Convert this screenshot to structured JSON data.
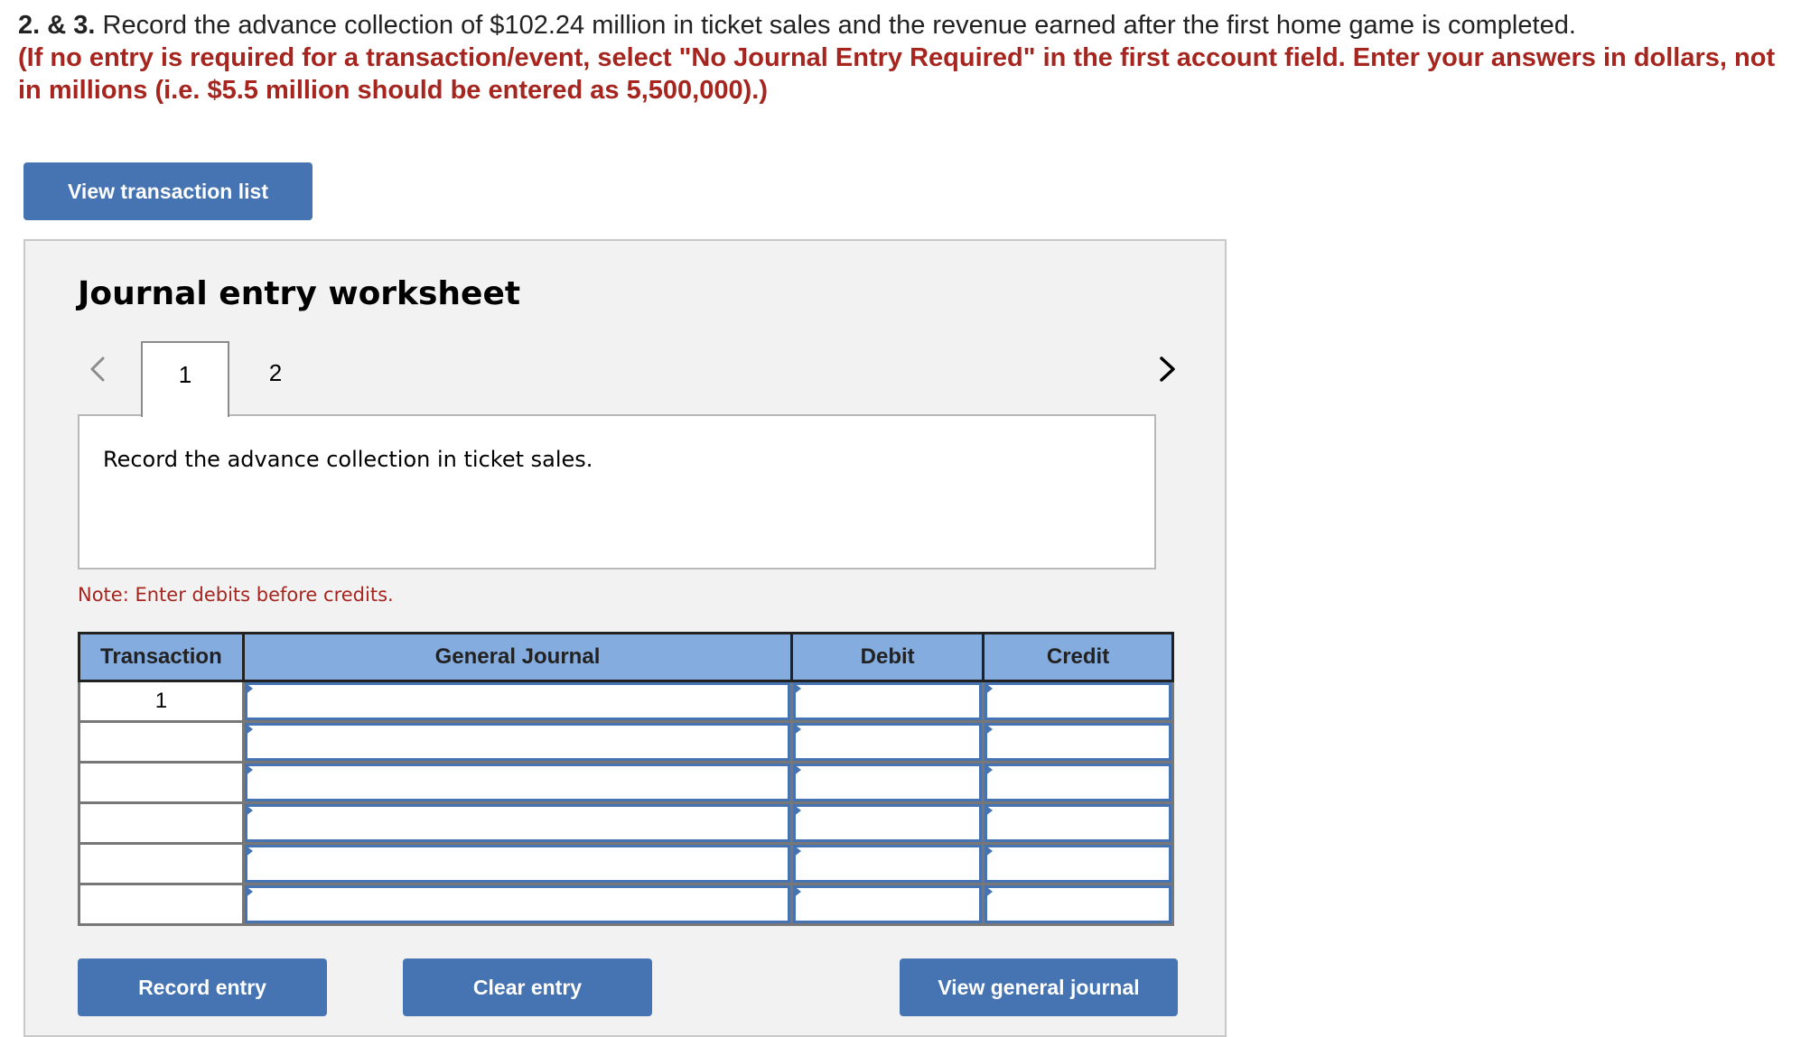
{
  "question": {
    "number": "2. & 3.",
    "text": "Record the advance collection of $102.24 million in ticket sales and the revenue earned after the first home game is completed.",
    "instructions": "(If no entry is required for a transaction/event, select \"No Journal Entry Required\" in the first account field. Enter your answers in dollars, not in millions (i.e. $5.5 million should be entered as 5,500,000).)"
  },
  "buttons": {
    "view_transaction_list": "View transaction list",
    "record_entry": "Record entry",
    "clear_entry": "Clear entry",
    "view_general_journal": "View general journal"
  },
  "worksheet": {
    "title": "Journal entry worksheet",
    "tabs": [
      {
        "label": "1",
        "active": true
      },
      {
        "label": "2",
        "active": false
      }
    ],
    "description": "Record the advance collection in ticket sales.",
    "note": "Note: Enter debits before credits."
  },
  "table": {
    "headers": [
      "Transaction",
      "General Journal",
      "Debit",
      "Credit"
    ],
    "rows": [
      {
        "transaction": "1",
        "account": "",
        "debit": "",
        "credit": ""
      },
      {
        "transaction": "",
        "account": "",
        "debit": "",
        "credit": ""
      },
      {
        "transaction": "",
        "account": "",
        "debit": "",
        "credit": ""
      },
      {
        "transaction": "",
        "account": "",
        "debit": "",
        "credit": ""
      },
      {
        "transaction": "",
        "account": "",
        "debit": "",
        "credit": ""
      },
      {
        "transaction": "",
        "account": "",
        "debit": "",
        "credit": ""
      }
    ]
  },
  "colors": {
    "accent": "#4674b2",
    "header_bg": "#84acdf",
    "instruction_red": "#a6251f",
    "panel_bg": "#f2f2f2"
  }
}
